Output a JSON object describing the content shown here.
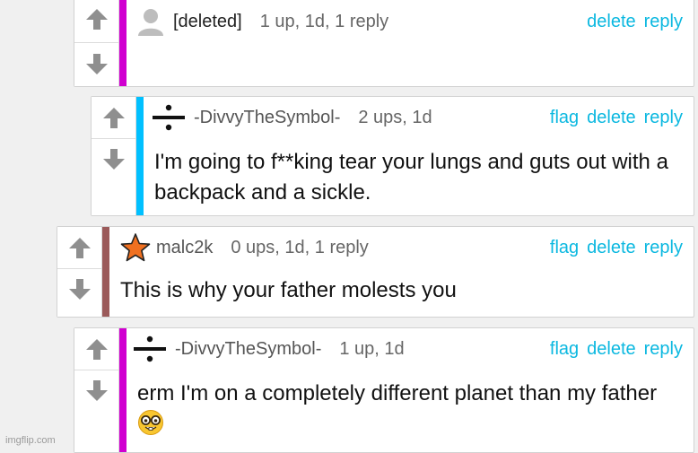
{
  "colors": {
    "bar_deleted": "#d000d0",
    "bar_divvy": "#00c0ff",
    "bar_malc": "#9b5a5a",
    "bar_divvy2": "#d000d0",
    "action_link": "#0bb8e0"
  },
  "icons": {
    "upvote": "arrow-up-icon",
    "downvote": "arrow-down-icon",
    "default_avatar": "user-silhouette-icon",
    "divide_avatar": "divide-symbol-icon",
    "star_avatar": "orange-star-icon",
    "emoji": "nerd-face-emoji"
  },
  "comments": [
    {
      "author": "[deleted]",
      "stats": "1 up, 1d, 1 reply",
      "actions": [
        "delete",
        "reply"
      ],
      "text": ""
    },
    {
      "author": "-DivvyTheSymbol-",
      "stats": "2 ups, 1d",
      "actions": [
        "flag",
        "delete",
        "reply"
      ],
      "text": "I'm going to f**king tear your lungs and guts out with a backpack and a sickle."
    },
    {
      "author": "malc2k",
      "stats": "0 ups, 1d, 1 reply",
      "actions": [
        "flag",
        "delete",
        "reply"
      ],
      "text": "This is why your father molests you"
    },
    {
      "author": "-DivvyTheSymbol-",
      "stats": "1 up, 1d",
      "actions": [
        "flag",
        "delete",
        "reply"
      ],
      "text": "erm I'm on a completely different planet than my father"
    }
  ],
  "watermark": "imgflip.com"
}
